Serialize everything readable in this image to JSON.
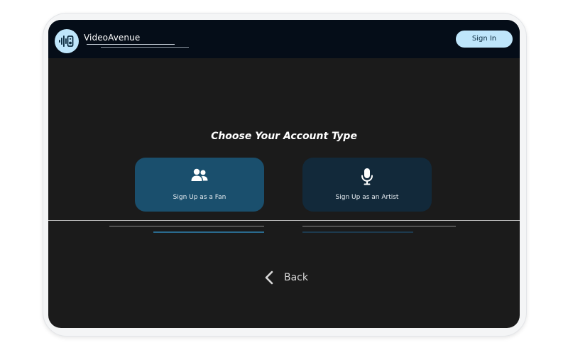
{
  "header": {
    "brand_name": "VideoAvenue",
    "logo_icon": "sound-wave-icon",
    "sign_in_label": "Sign In"
  },
  "main": {
    "title": "Choose Your Account Type",
    "options": [
      {
        "label": "Sign Up as a Fan",
        "icon": "users-icon"
      },
      {
        "label": "Sign Up as an Artist",
        "icon": "microphone-icon"
      }
    ],
    "back_label": "Back",
    "back_icon": "chevron-left-icon"
  },
  "colors": {
    "screen_background": "#1b1b1b",
    "header_background": "#050d18",
    "accent_light_blue": "#bfe6fb",
    "fan_card": "#1a4f6d",
    "artist_card": "#12293a"
  }
}
